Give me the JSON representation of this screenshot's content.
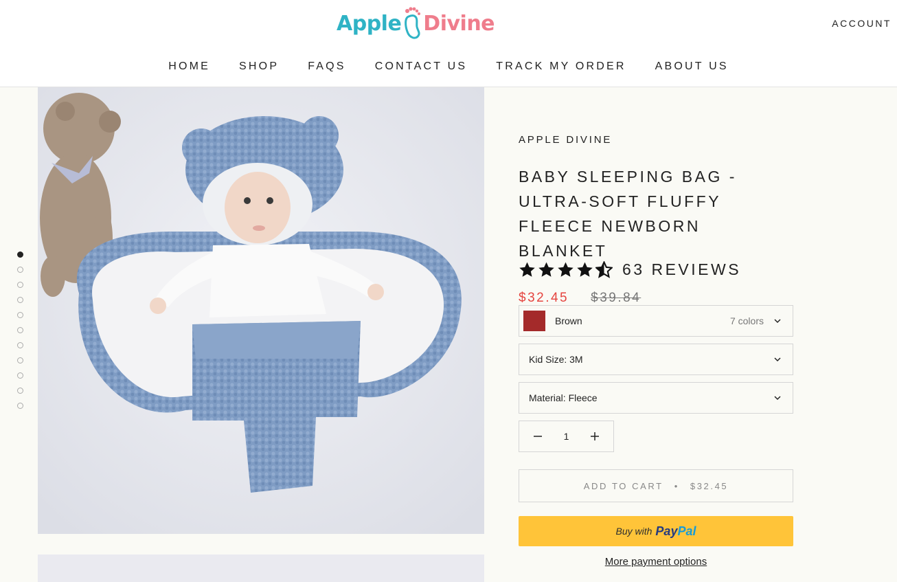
{
  "header": {
    "logo_part1": "Apple",
    "logo_part2": "Divine",
    "account_label": "ACCOUNT",
    "nav": [
      "HOME",
      "SHOP",
      "FAQS",
      "CONTACT US",
      "TRACK MY ORDER",
      "ABOUT US"
    ]
  },
  "gallery": {
    "image_count": 11,
    "active_index": 0
  },
  "product": {
    "vendor": "APPLE DIVINE",
    "title": "BABY SLEEPING BAG - ULTRA-SOFT FLUFFY FLEECE NEWBORN BLANKET",
    "rating": 4.5,
    "reviews_label": "63 REVIEWS",
    "price": "$32.45",
    "compare_price": "$39.84"
  },
  "options": {
    "color_value": "Brown",
    "color_count": "7 colors",
    "swatch_color": "#a42a2a",
    "size_label": "Kid Size: 3M",
    "material_label": "Material: Fleece"
  },
  "quantity": {
    "value": "1"
  },
  "cart": {
    "label": "ADD TO CART",
    "separator": "•",
    "price": "$32.45"
  },
  "paypal": {
    "buy_with": "Buy with",
    "brand_pay": "Pay",
    "brand_pal": "Pal"
  },
  "more_payment": "More payment options",
  "colors": {
    "accent_red": "#e5443f",
    "paypal_yellow": "#ffc439",
    "logo_teal": "#2fb3c5",
    "logo_pink": "#ef7d8c"
  }
}
